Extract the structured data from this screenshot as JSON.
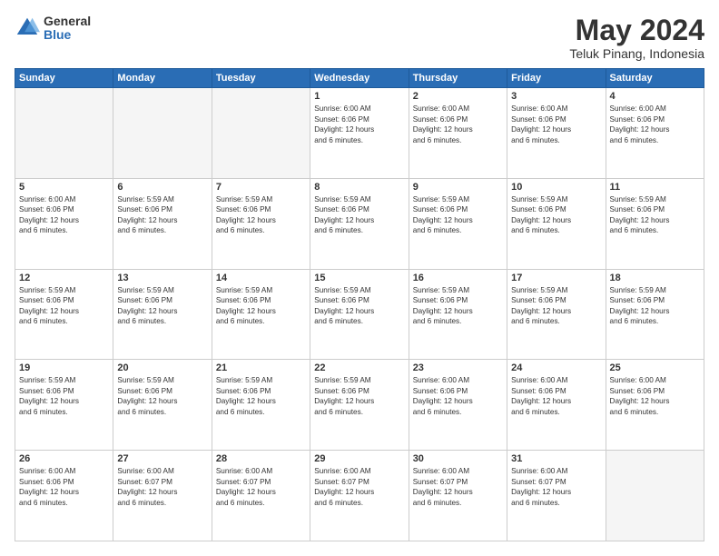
{
  "logo": {
    "general": "General",
    "blue": "Blue"
  },
  "title": "May 2024",
  "subtitle": "Teluk Pinang, Indonesia",
  "days_of_week": [
    "Sunday",
    "Monday",
    "Tuesday",
    "Wednesday",
    "Thursday",
    "Friday",
    "Saturday"
  ],
  "weeks": [
    [
      {
        "day": "",
        "info": ""
      },
      {
        "day": "",
        "info": ""
      },
      {
        "day": "",
        "info": ""
      },
      {
        "day": "1",
        "info": "Sunrise: 6:00 AM\nSunset: 6:06 PM\nDaylight: 12 hours\nand 6 minutes."
      },
      {
        "day": "2",
        "info": "Sunrise: 6:00 AM\nSunset: 6:06 PM\nDaylight: 12 hours\nand 6 minutes."
      },
      {
        "day": "3",
        "info": "Sunrise: 6:00 AM\nSunset: 6:06 PM\nDaylight: 12 hours\nand 6 minutes."
      },
      {
        "day": "4",
        "info": "Sunrise: 6:00 AM\nSunset: 6:06 PM\nDaylight: 12 hours\nand 6 minutes."
      }
    ],
    [
      {
        "day": "5",
        "info": "Sunrise: 6:00 AM\nSunset: 6:06 PM\nDaylight: 12 hours\nand 6 minutes."
      },
      {
        "day": "6",
        "info": "Sunrise: 5:59 AM\nSunset: 6:06 PM\nDaylight: 12 hours\nand 6 minutes."
      },
      {
        "day": "7",
        "info": "Sunrise: 5:59 AM\nSunset: 6:06 PM\nDaylight: 12 hours\nand 6 minutes."
      },
      {
        "day": "8",
        "info": "Sunrise: 5:59 AM\nSunset: 6:06 PM\nDaylight: 12 hours\nand 6 minutes."
      },
      {
        "day": "9",
        "info": "Sunrise: 5:59 AM\nSunset: 6:06 PM\nDaylight: 12 hours\nand 6 minutes."
      },
      {
        "day": "10",
        "info": "Sunrise: 5:59 AM\nSunset: 6:06 PM\nDaylight: 12 hours\nand 6 minutes."
      },
      {
        "day": "11",
        "info": "Sunrise: 5:59 AM\nSunset: 6:06 PM\nDaylight: 12 hours\nand 6 minutes."
      }
    ],
    [
      {
        "day": "12",
        "info": "Sunrise: 5:59 AM\nSunset: 6:06 PM\nDaylight: 12 hours\nand 6 minutes."
      },
      {
        "day": "13",
        "info": "Sunrise: 5:59 AM\nSunset: 6:06 PM\nDaylight: 12 hours\nand 6 minutes."
      },
      {
        "day": "14",
        "info": "Sunrise: 5:59 AM\nSunset: 6:06 PM\nDaylight: 12 hours\nand 6 minutes."
      },
      {
        "day": "15",
        "info": "Sunrise: 5:59 AM\nSunset: 6:06 PM\nDaylight: 12 hours\nand 6 minutes."
      },
      {
        "day": "16",
        "info": "Sunrise: 5:59 AM\nSunset: 6:06 PM\nDaylight: 12 hours\nand 6 minutes."
      },
      {
        "day": "17",
        "info": "Sunrise: 5:59 AM\nSunset: 6:06 PM\nDaylight: 12 hours\nand 6 minutes."
      },
      {
        "day": "18",
        "info": "Sunrise: 5:59 AM\nSunset: 6:06 PM\nDaylight: 12 hours\nand 6 minutes."
      }
    ],
    [
      {
        "day": "19",
        "info": "Sunrise: 5:59 AM\nSunset: 6:06 PM\nDaylight: 12 hours\nand 6 minutes."
      },
      {
        "day": "20",
        "info": "Sunrise: 5:59 AM\nSunset: 6:06 PM\nDaylight: 12 hours\nand 6 minutes."
      },
      {
        "day": "21",
        "info": "Sunrise: 5:59 AM\nSunset: 6:06 PM\nDaylight: 12 hours\nand 6 minutes."
      },
      {
        "day": "22",
        "info": "Sunrise: 5:59 AM\nSunset: 6:06 PM\nDaylight: 12 hours\nand 6 minutes."
      },
      {
        "day": "23",
        "info": "Sunrise: 6:00 AM\nSunset: 6:06 PM\nDaylight: 12 hours\nand 6 minutes."
      },
      {
        "day": "24",
        "info": "Sunrise: 6:00 AM\nSunset: 6:06 PM\nDaylight: 12 hours\nand 6 minutes."
      },
      {
        "day": "25",
        "info": "Sunrise: 6:00 AM\nSunset: 6:06 PM\nDaylight: 12 hours\nand 6 minutes."
      }
    ],
    [
      {
        "day": "26",
        "info": "Sunrise: 6:00 AM\nSunset: 6:06 PM\nDaylight: 12 hours\nand 6 minutes."
      },
      {
        "day": "27",
        "info": "Sunrise: 6:00 AM\nSunset: 6:07 PM\nDaylight: 12 hours\nand 6 minutes."
      },
      {
        "day": "28",
        "info": "Sunrise: 6:00 AM\nSunset: 6:07 PM\nDaylight: 12 hours\nand 6 minutes."
      },
      {
        "day": "29",
        "info": "Sunrise: 6:00 AM\nSunset: 6:07 PM\nDaylight: 12 hours\nand 6 minutes."
      },
      {
        "day": "30",
        "info": "Sunrise: 6:00 AM\nSunset: 6:07 PM\nDaylight: 12 hours\nand 6 minutes."
      },
      {
        "day": "31",
        "info": "Sunrise: 6:00 AM\nSunset: 6:07 PM\nDaylight: 12 hours\nand 6 minutes."
      },
      {
        "day": "",
        "info": ""
      }
    ]
  ]
}
